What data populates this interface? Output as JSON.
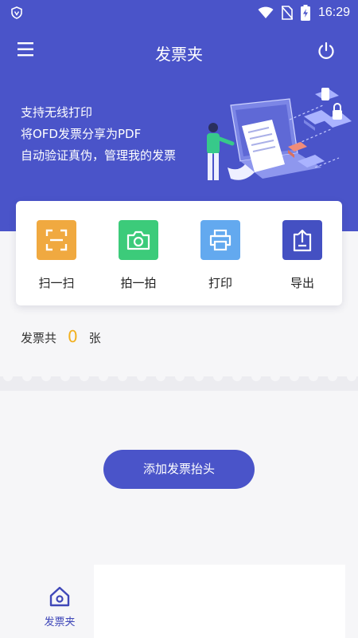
{
  "status_bar": {
    "time": "16:29"
  },
  "header": {
    "title": "发票夹"
  },
  "hero": {
    "features": [
      "支持无线打印",
      "将OFD发票分享为PDF",
      "自动验证真伪，管理我的发票"
    ]
  },
  "actions": [
    {
      "label": "扫一扫",
      "icon": "scan-icon",
      "color": "#f0a940"
    },
    {
      "label": "拍一拍",
      "icon": "camera-icon",
      "color": "#3ccb7a"
    },
    {
      "label": "打印",
      "icon": "printer-icon",
      "color": "#63a9ef"
    },
    {
      "label": "导出",
      "icon": "export-icon",
      "color": "#4450c2"
    }
  ],
  "invoice_count": {
    "prefix": "发票共",
    "count": "0",
    "suffix": "张"
  },
  "add_button": {
    "label": "添加发票抬头"
  },
  "bottom_nav": {
    "home_label": "发票夹"
  },
  "colors": {
    "primary": "#4a54c9",
    "count": "#f2b01e"
  }
}
